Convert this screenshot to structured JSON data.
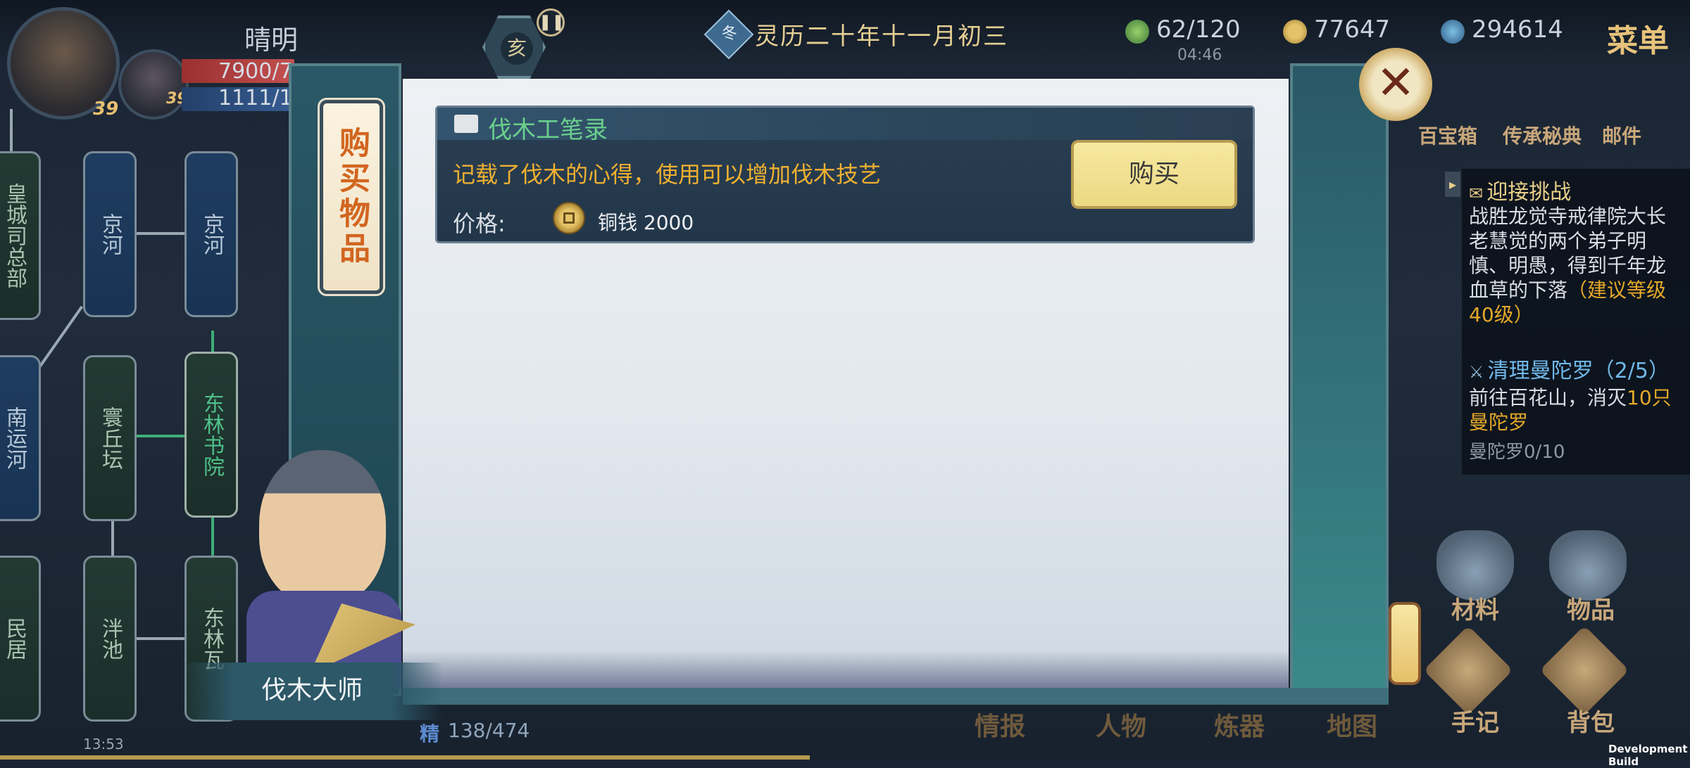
{
  "top_bar": {
    "player_name": "晴明",
    "main_level": "39",
    "sub_level": "39",
    "hp": "7900/7",
    "mp": "1111/1",
    "hour_glyph": "亥",
    "season_glyph": "冬",
    "date": "灵历二十年十一月初三",
    "stamina": "62/120",
    "stamina_timer": "04:46",
    "copper": "77647",
    "spirit": "294614",
    "menu_label": "菜单"
  },
  "map": {
    "nodes": [
      "皇城司总部",
      "京河",
      "京河",
      "南运河",
      "寰丘坛",
      "东林书院",
      "民居",
      "泮池",
      "东林瓦"
    ]
  },
  "dialog": {
    "title": "购买物品",
    "item_name": "伐木工笔录",
    "item_desc": "记载了伐木的心得，使用可以增加伐木技艺",
    "price_label": "价格:",
    "price_value": "铜钱 2000",
    "buy_label": "购买",
    "close_glyph": "✕"
  },
  "npc": {
    "name": "伐木大师"
  },
  "shortcuts_top": [
    "百宝箱",
    "传承秘典",
    "邮件"
  ],
  "quests": [
    {
      "title": "迎接挑战",
      "desc": "战胜龙觉寺戒律院大长老慧觉的两个弟子明慎、明愚，得到千年龙血草的下落",
      "hint": "（建议等级40级）"
    },
    {
      "title": "清理曼陀罗（2/5）",
      "desc_a": "前往百花山，消灭",
      "desc_b": "10只曼陀罗",
      "progress": "曼陀罗0/10"
    }
  ],
  "bag_buttons": [
    "材料",
    "物品"
  ],
  "bottom_right_buttons": [
    "手记",
    "背包"
  ],
  "bottom_tabs": [
    "情报",
    "人物",
    "炼器",
    "地图"
  ],
  "bottom_stat": {
    "label": "精",
    "value": "138/474"
  },
  "status_clock": "13:53",
  "watermark": "Development Build"
}
